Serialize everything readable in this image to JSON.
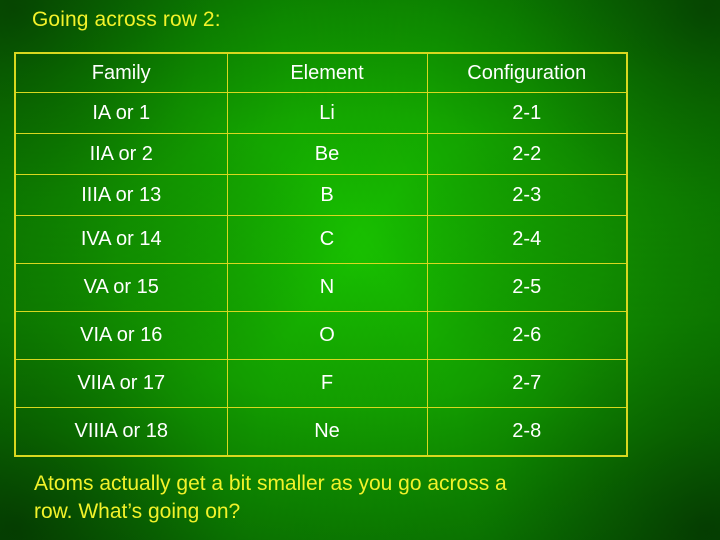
{
  "slide": {
    "title": "Going across row 2:",
    "footer_line1": "Atoms actually get a bit smaller as you go across a",
    "footer_line2": "row.  What’s going on?",
    "colors": {
      "title_text": "#f2f22a",
      "table_border": "#d8d81f",
      "table_text": "#ffffff",
      "background_green": "#0f9e00"
    }
  },
  "table": {
    "headers": [
      "Family",
      "Element",
      "Configuration"
    ],
    "rows": [
      {
        "family": "IA or 1",
        "element": "Li",
        "configuration": "2-1"
      },
      {
        "family": "IIA or 2",
        "element": "Be",
        "configuration": "2-2"
      },
      {
        "family": "IIIA or 13",
        "element": "B",
        "configuration": "2-3"
      },
      {
        "family": "IVA or 14",
        "element": "C",
        "configuration": "2-4"
      },
      {
        "family": "VA or 15",
        "element": "N",
        "configuration": "2-5"
      },
      {
        "family": "VIA or 16",
        "element": "O",
        "configuration": "2-6"
      },
      {
        "family": "VIIA or 17",
        "element": "F",
        "configuration": "2-7"
      },
      {
        "family": "VIIIA or 18",
        "element": "Ne",
        "configuration": "2-8"
      }
    ]
  }
}
